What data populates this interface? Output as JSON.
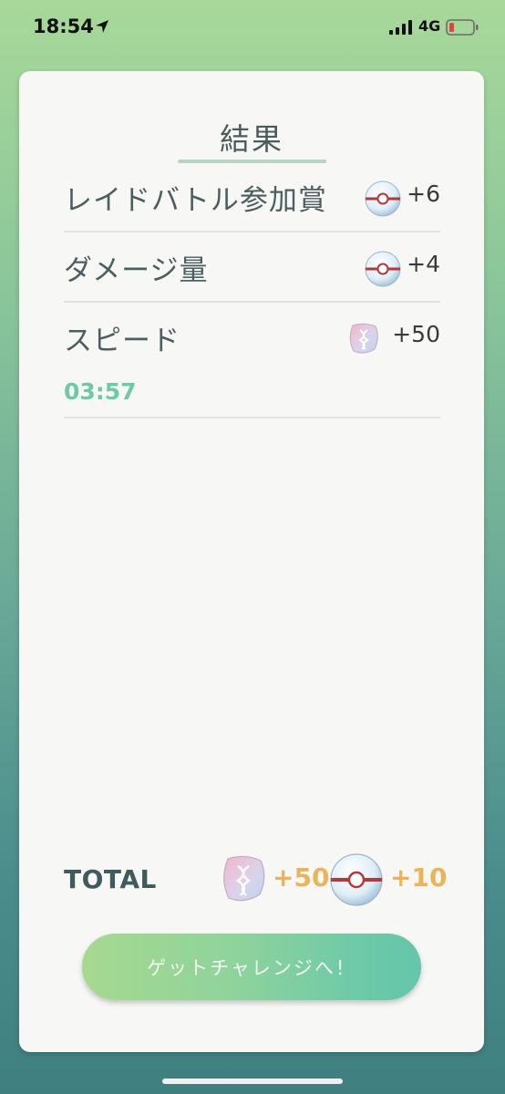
{
  "status_bar": {
    "time": "18:54",
    "network": "4G",
    "icons": [
      "location-arrow-icon",
      "signal-bars-icon",
      "battery-low-icon"
    ]
  },
  "result": {
    "title": "結果",
    "rows": [
      {
        "label": "レイドバトル参加賞",
        "reward_icon": "premier-ball-icon",
        "value": "+6"
      },
      {
        "label": "ダメージ量",
        "reward_icon": "premier-ball-icon",
        "value": "+4"
      },
      {
        "label": "スピード",
        "reward_icon": "rare-candy-icon",
        "value": "+50",
        "time": "03:57"
      }
    ]
  },
  "total": {
    "label": "TOTAL",
    "candy_icon": "rare-candy-icon",
    "candy_value": "+50",
    "ball_icon": "premier-ball-icon",
    "ball_value": "+10"
  },
  "cta": {
    "label": "ゲットチャレンジへ！"
  },
  "colors": {
    "accent_green": "#6ec9a6",
    "total_value": "#e9b45a",
    "text_dark": "#4c5f60"
  }
}
